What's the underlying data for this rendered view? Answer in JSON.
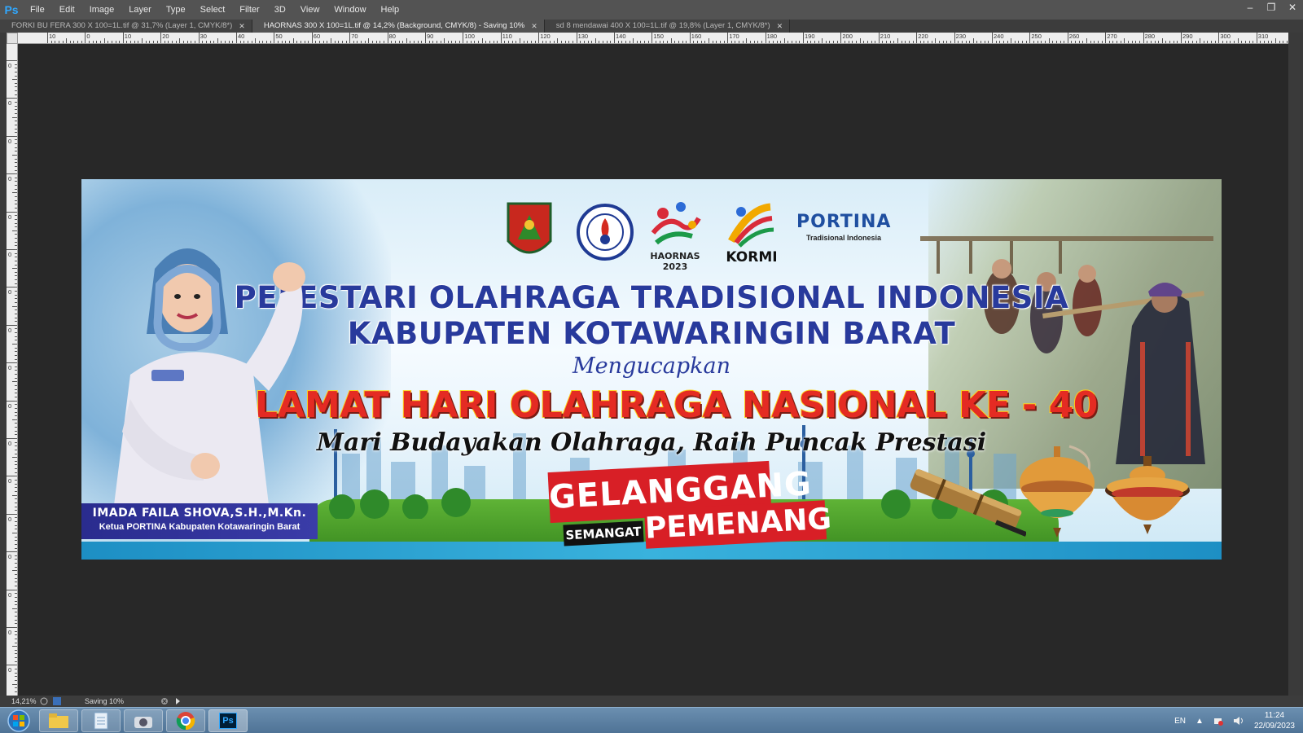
{
  "app": {
    "logo": "Ps"
  },
  "menu": [
    "File",
    "Edit",
    "Image",
    "Layer",
    "Type",
    "Select",
    "Filter",
    "3D",
    "View",
    "Window",
    "Help"
  ],
  "window_controls": {
    "minimize_icon": "minimize-icon",
    "restore_icon": "restore-icon",
    "close_icon": "close-icon"
  },
  "tabs": [
    {
      "label": "FORKI BU FERA 300 X 100=1L.tif @ 31,7% (Layer 1, CMYK/8*)",
      "active": false
    },
    {
      "label": "HAORNAS 300 X 100=1L.tif @ 14,2% (Background, CMYK/8) - Saving 10%",
      "active": true
    },
    {
      "label": "sd 8 mendawai 400 X 100=1L.tif @ 19,8% (Layer 1, CMYK/8*)",
      "active": false
    }
  ],
  "ruler_h": [
    "10",
    "0",
    "10",
    "20",
    "30",
    "40",
    "50",
    "60",
    "70",
    "80",
    "90",
    "100",
    "110",
    "120",
    "130",
    "140",
    "150",
    "160",
    "170",
    "180",
    "190",
    "200",
    "210",
    "220",
    "230",
    "240",
    "250",
    "260",
    "270",
    "280",
    "290",
    "300",
    "310"
  ],
  "ruler_v": [
    "0",
    "0",
    "0",
    "0",
    "0",
    "0",
    "0",
    "0",
    "0",
    "0",
    "0",
    "0",
    "0",
    "0",
    "0",
    "0",
    "0"
  ],
  "banner": {
    "logos": {
      "haornas": "HAORNAS 2023",
      "kormi": "KORMI",
      "portina": "PORTINA",
      "portina_sub": "Tradisional Indonesia"
    },
    "line1": "PELESTARI OLAHRAGA TRADISIONAL INDONESIA",
    "line2": "KABUPATEN KOTAWARINGIN BARAT",
    "line3": "Mengucapkan",
    "line4": "SELAMAT HARI OLAHRAGA NASIONAL KE - 40",
    "line5": "Mari Budayakan Olahraga, Raih Puncak Prestasi",
    "badge_gelanggang": "GELANGGANG",
    "badge_semangat": "SEMANGAT",
    "badge_pemenang": "PEMENANG",
    "name": "IMADA FAILA SHOVA,S.H.,M.Kn.",
    "title": "Ketua PORTINA Kabupaten Kotawaringin Barat"
  },
  "status": {
    "zoom": "14,21%",
    "doc_info": "Saving 10%"
  },
  "taskbar": {
    "apps": [
      "explorer-icon",
      "notepad-icon",
      "camera-icon",
      "chrome-icon",
      "photoshop-icon"
    ],
    "ps_label": "Ps",
    "lang": "EN",
    "time": "11:24",
    "date": "22/09/2023"
  },
  "colors": {
    "banner_blue": "#283a9c",
    "banner_red": "#e42b23",
    "banner_yellow": "#ffd21a",
    "ps_bg": "#282828"
  }
}
